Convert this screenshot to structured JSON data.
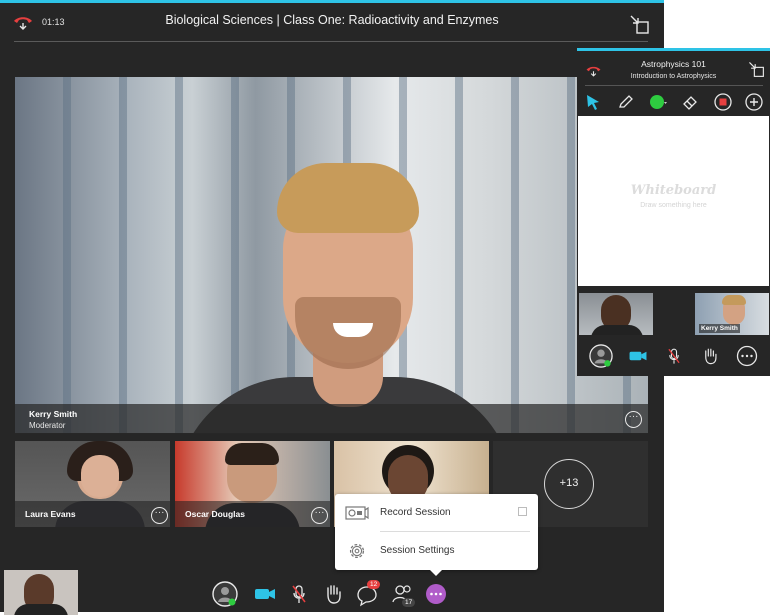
{
  "main_window": {
    "timer": "01:13",
    "title": "Biological Sciences | Class One: Radioactivity and Enzymes",
    "presenter": {
      "name": "Kerry Smith",
      "role": "Moderator"
    },
    "participants": [
      {
        "name": "Laura Evans"
      },
      {
        "name": "Oscar Douglas"
      },
      {
        "name": ""
      }
    ],
    "more_count": "+13",
    "menu": {
      "items": [
        {
          "label": "Record Session",
          "icon": "record-session-icon"
        },
        {
          "label": "Session Settings",
          "icon": "gear-icon"
        }
      ]
    },
    "toolbar": {
      "chat_badge": "12",
      "attendees_badge": "17"
    },
    "colors": {
      "accent": "#2ec3e6",
      "record": "#e63f3f",
      "more_active": "#b05cc9"
    }
  },
  "side_window": {
    "title": "Astrophysics 101",
    "subtitle": "Introduction to Astrophysics",
    "whiteboard": {
      "title": "Whiteboard",
      "subtitle": "Draw something here"
    },
    "participants": [
      {
        "name": ""
      },
      {
        "name": "Kerry Smith"
      }
    ],
    "colors": {
      "pointer": "#2ec3e6",
      "color_tool": "#2ecc40",
      "stop": "#e63f3f"
    }
  }
}
